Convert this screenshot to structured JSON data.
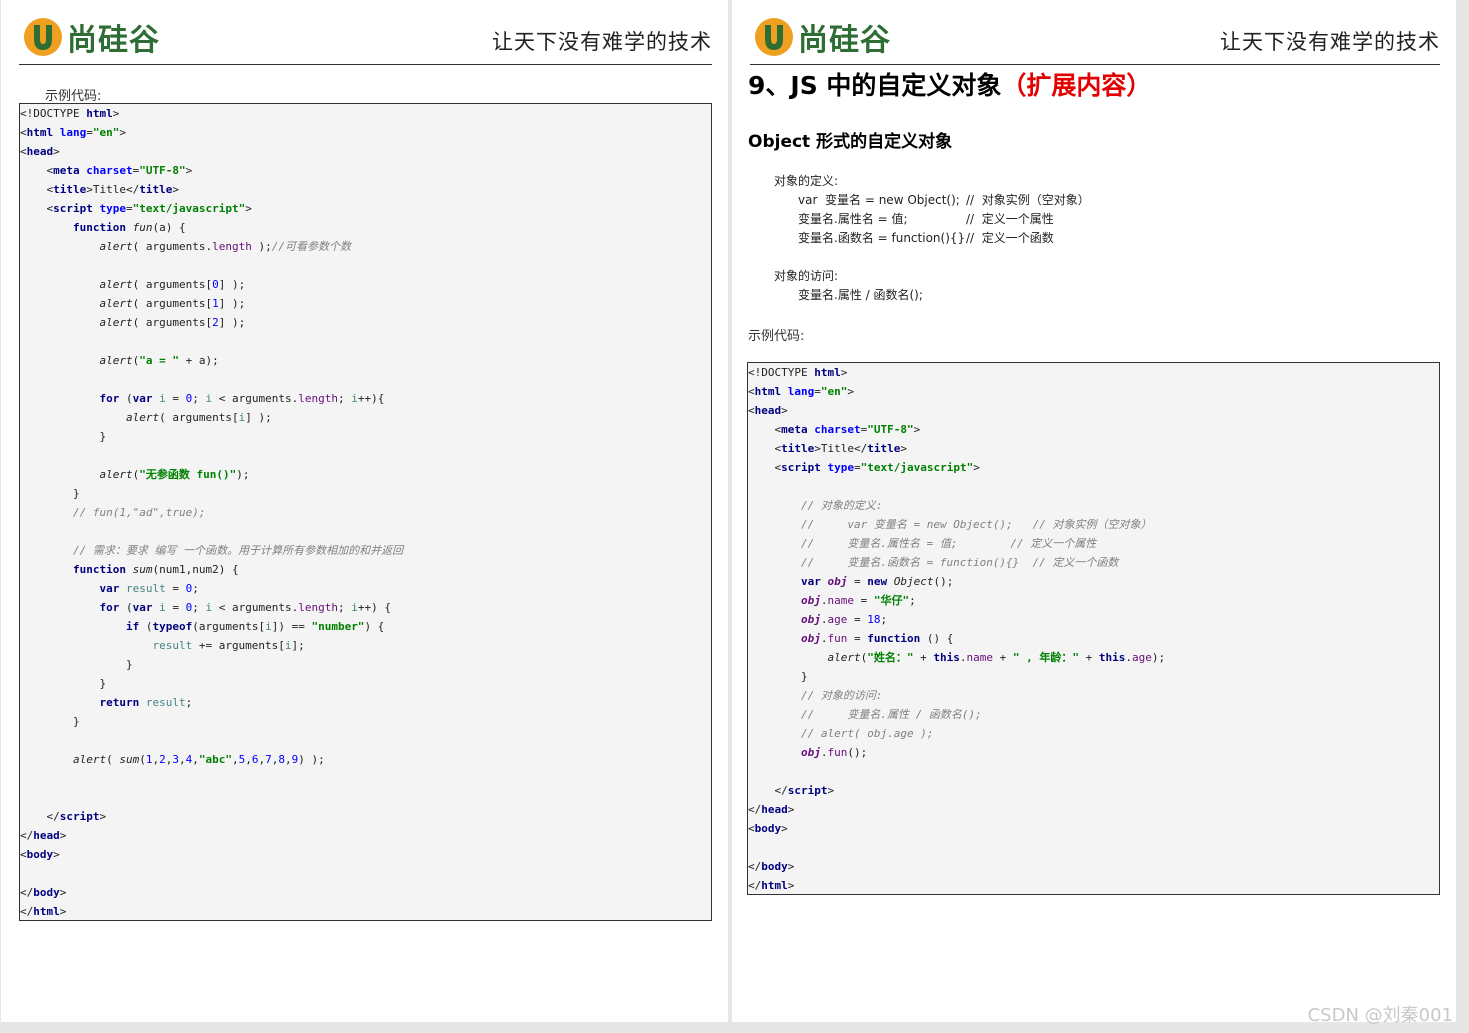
{
  "header": {
    "logo_text": "尚硅谷",
    "slogan": "让天下没有难学的技术"
  },
  "left_page": {
    "example_label": "示例代码:",
    "code_lines": [
      [
        [
          "",
          "<!DOCTYPE "
        ],
        [
          "tag",
          "html"
        ],
        [
          "",
          ">"
        ]
      ],
      [
        [
          "",
          "<"
        ],
        [
          "tag",
          "html "
        ],
        [
          "attr",
          "lang"
        ],
        [
          "",
          "="
        ],
        [
          "str",
          "\"en\""
        ],
        [
          "",
          ">"
        ]
      ],
      [
        [
          "",
          "<"
        ],
        [
          "tag",
          "head"
        ],
        [
          "",
          ">"
        ]
      ],
      [
        [
          "",
          "    <"
        ],
        [
          "tag",
          "meta "
        ],
        [
          "attr",
          "charset"
        ],
        [
          "",
          "="
        ],
        [
          "str",
          "\"UTF-8\""
        ],
        [
          "",
          ">"
        ]
      ],
      [
        [
          "",
          "    <"
        ],
        [
          "tag",
          "title"
        ],
        [
          "",
          ">Title</"
        ],
        [
          "tag",
          "title"
        ],
        [
          "",
          ">"
        ]
      ],
      [
        [
          "",
          "    <"
        ],
        [
          "tag",
          "script "
        ],
        [
          "attr",
          "type"
        ],
        [
          "",
          "="
        ],
        [
          "str",
          "\"text/javascript\""
        ],
        [
          "",
          ">"
        ]
      ],
      [
        [
          "",
          "        "
        ],
        [
          "kw",
          "function "
        ],
        [
          "fn",
          "fun"
        ],
        [
          "",
          "(a) {"
        ]
      ],
      [
        [
          "",
          "            "
        ],
        [
          "fn",
          "alert"
        ],
        [
          "",
          "( arguments."
        ],
        [
          "fld",
          "length"
        ],
        [
          "",
          " );"
        ],
        [
          "cm",
          "//可看参数个数"
        ]
      ],
      [
        [
          "",
          ""
        ]
      ],
      [
        [
          "",
          "            "
        ],
        [
          "fn",
          "alert"
        ],
        [
          "",
          "( arguments["
        ],
        [
          "num",
          "0"
        ],
        [
          "",
          "] );"
        ]
      ],
      [
        [
          "",
          "            "
        ],
        [
          "fn",
          "alert"
        ],
        [
          "",
          "( arguments["
        ],
        [
          "num",
          "1"
        ],
        [
          "",
          "] );"
        ]
      ],
      [
        [
          "",
          "            "
        ],
        [
          "fn",
          "alert"
        ],
        [
          "",
          "( arguments["
        ],
        [
          "num",
          "2"
        ],
        [
          "",
          "] );"
        ]
      ],
      [
        [
          "",
          ""
        ]
      ],
      [
        [
          "",
          "            "
        ],
        [
          "fn",
          "alert"
        ],
        [
          "",
          "("
        ],
        [
          "str",
          "\"a = \""
        ],
        [
          "",
          " + a);"
        ]
      ],
      [
        [
          "",
          ""
        ]
      ],
      [
        [
          "",
          "            "
        ],
        [
          "kw",
          "for "
        ],
        [
          "",
          "("
        ],
        [
          "kw",
          "var "
        ],
        [
          "var",
          "i"
        ],
        [
          "",
          " = "
        ],
        [
          "num",
          "0"
        ],
        [
          "",
          "; "
        ],
        [
          "var",
          "i"
        ],
        [
          "",
          " < arguments."
        ],
        [
          "fld",
          "length"
        ],
        [
          "",
          "; "
        ],
        [
          "var",
          "i"
        ],
        [
          "",
          "++){"
        ]
      ],
      [
        [
          "",
          "                "
        ],
        [
          "fn",
          "alert"
        ],
        [
          "",
          "( arguments["
        ],
        [
          "var",
          "i"
        ],
        [
          "",
          "] );"
        ]
      ],
      [
        [
          "",
          "            }"
        ]
      ],
      [
        [
          "",
          ""
        ]
      ],
      [
        [
          "",
          "            "
        ],
        [
          "fn",
          "alert"
        ],
        [
          "",
          "("
        ],
        [
          "str",
          "\"无参函数 fun()\""
        ],
        [
          "",
          ");"
        ]
      ],
      [
        [
          "",
          "        }"
        ]
      ],
      [
        [
          "",
          "        "
        ],
        [
          "cm",
          "// fun(1,\"ad\",true);"
        ]
      ],
      [
        [
          "",
          ""
        ]
      ],
      [
        [
          "",
          "        "
        ],
        [
          "cm",
          "// 需求：要求 编写 一个函数。用于计算所有参数相加的和并返回"
        ]
      ],
      [
        [
          "",
          "        "
        ],
        [
          "kw",
          "function "
        ],
        [
          "fn",
          "sum"
        ],
        [
          "",
          "(num1,num2) {"
        ]
      ],
      [
        [
          "",
          "            "
        ],
        [
          "kw",
          "var "
        ],
        [
          "var",
          "result"
        ],
        [
          "",
          " = "
        ],
        [
          "num",
          "0"
        ],
        [
          "",
          ";"
        ]
      ],
      [
        [
          "",
          "            "
        ],
        [
          "kw",
          "for "
        ],
        [
          "",
          "("
        ],
        [
          "kw",
          "var "
        ],
        [
          "var",
          "i"
        ],
        [
          "",
          " = "
        ],
        [
          "num",
          "0"
        ],
        [
          "",
          "; "
        ],
        [
          "var",
          "i"
        ],
        [
          "",
          " < arguments."
        ],
        [
          "fld",
          "length"
        ],
        [
          "",
          "; "
        ],
        [
          "var",
          "i"
        ],
        [
          "",
          "++) {"
        ]
      ],
      [
        [
          "",
          "                "
        ],
        [
          "kw",
          "if "
        ],
        [
          "",
          "("
        ],
        [
          "kw",
          "typeof"
        ],
        [
          "",
          "(arguments["
        ],
        [
          "var",
          "i"
        ],
        [
          "",
          "]) == "
        ],
        [
          "str",
          "\"number\""
        ],
        [
          "",
          ") {"
        ]
      ],
      [
        [
          "",
          "                    "
        ],
        [
          "var",
          "result"
        ],
        [
          "",
          " += arguments["
        ],
        [
          "var",
          "i"
        ],
        [
          "",
          "];"
        ]
      ],
      [
        [
          "",
          "                }"
        ]
      ],
      [
        [
          "",
          "            }"
        ]
      ],
      [
        [
          "",
          "            "
        ],
        [
          "kw",
          "return "
        ],
        [
          "var",
          "result"
        ],
        [
          "",
          ";"
        ]
      ],
      [
        [
          "",
          "        }"
        ]
      ],
      [
        [
          "",
          ""
        ]
      ],
      [
        [
          "",
          "        "
        ],
        [
          "fn",
          "alert"
        ],
        [
          "",
          "( "
        ],
        [
          "fn",
          "sum"
        ],
        [
          "",
          "("
        ],
        [
          "num",
          "1"
        ],
        [
          "",
          ","
        ],
        [
          "num",
          "2"
        ],
        [
          "",
          ","
        ],
        [
          "num",
          "3"
        ],
        [
          "",
          ","
        ],
        [
          "num",
          "4"
        ],
        [
          "",
          ","
        ],
        [
          "str",
          "\"abc\""
        ],
        [
          "",
          ","
        ],
        [
          "num",
          "5"
        ],
        [
          "",
          ","
        ],
        [
          "num",
          "6"
        ],
        [
          "",
          ","
        ],
        [
          "num",
          "7"
        ],
        [
          "",
          ","
        ],
        [
          "num",
          "8"
        ],
        [
          "",
          ","
        ],
        [
          "num",
          "9"
        ],
        [
          "",
          ") );"
        ]
      ],
      [
        [
          "",
          ""
        ]
      ],
      [
        [
          "",
          ""
        ]
      ],
      [
        [
          "",
          "    </"
        ],
        [
          "tag",
          "script"
        ],
        [
          "",
          ">"
        ]
      ],
      [
        [
          "",
          "</"
        ],
        [
          "tag",
          "head"
        ],
        [
          "",
          ">"
        ]
      ],
      [
        [
          "",
          "<"
        ],
        [
          "tag",
          "body"
        ],
        [
          "",
          ">"
        ]
      ],
      [
        [
          "",
          ""
        ]
      ],
      [
        [
          "",
          "</"
        ],
        [
          "tag",
          "body"
        ],
        [
          "",
          ">"
        ]
      ],
      [
        [
          "",
          "</"
        ],
        [
          "tag",
          "html"
        ],
        [
          "",
          ">"
        ]
      ]
    ]
  },
  "right_page": {
    "section_title_main": "9、JS 中的自定义对象",
    "section_title_note": "（扩展内容）",
    "subsection_title": "Object 形式的自定义对象",
    "definition": {
      "label": "对象的定义:",
      "rows": [
        [
          "var  变量名 = new Object();",
          "//  对象实例（空对象）"
        ],
        [
          "变量名.属性名 = 值;",
          "//  定义一个属性"
        ],
        [
          "变量名.函数名 = function(){}",
          "//  定义一个函数"
        ]
      ]
    },
    "access": {
      "label": "对象的访问:",
      "text": "变量名.属性 / 函数名();"
    },
    "example_label": "示例代码:",
    "code_lines": [
      [
        [
          "",
          "<!DOCTYPE "
        ],
        [
          "tag",
          "html"
        ],
        [
          "",
          ">"
        ]
      ],
      [
        [
          "",
          "<"
        ],
        [
          "tag",
          "html "
        ],
        [
          "attr",
          "lang"
        ],
        [
          "",
          "="
        ],
        [
          "str",
          "\"en\""
        ],
        [
          "",
          ">"
        ]
      ],
      [
        [
          "",
          "<"
        ],
        [
          "tag",
          "head"
        ],
        [
          "",
          ">"
        ]
      ],
      [
        [
          "",
          "    <"
        ],
        [
          "tag",
          "meta "
        ],
        [
          "attr",
          "charset"
        ],
        [
          "",
          "="
        ],
        [
          "str",
          "\"UTF-8\""
        ],
        [
          "",
          ">"
        ]
      ],
      [
        [
          "",
          "    <"
        ],
        [
          "tag",
          "title"
        ],
        [
          "",
          ">Title</"
        ],
        [
          "tag",
          "title"
        ],
        [
          "",
          ">"
        ]
      ],
      [
        [
          "",
          "    <"
        ],
        [
          "tag",
          "script "
        ],
        [
          "attr",
          "type"
        ],
        [
          "",
          "="
        ],
        [
          "str",
          "\"text/javascript\""
        ],
        [
          "",
          ">"
        ]
      ],
      [
        [
          "",
          ""
        ]
      ],
      [
        [
          "",
          "        "
        ],
        [
          "cm",
          "// 对象的定义:"
        ]
      ],
      [
        [
          "",
          "        "
        ],
        [
          "cm",
          "//     var 变量名 = new Object();   // 对象实例（空对象）"
        ]
      ],
      [
        [
          "",
          "        "
        ],
        [
          "cm",
          "//     变量名.属性名 = 值;        // 定义一个属性"
        ]
      ],
      [
        [
          "",
          "        "
        ],
        [
          "cm",
          "//     变量名.函数名 = function(){}  // 定义一个函数"
        ]
      ],
      [
        [
          "",
          "        "
        ],
        [
          "kw",
          "var "
        ],
        [
          "obj",
          "obj"
        ],
        [
          "",
          " = "
        ],
        [
          "kw",
          "new "
        ],
        [
          "fn",
          "Object"
        ],
        [
          "",
          "();"
        ]
      ],
      [
        [
          "",
          "        "
        ],
        [
          "obj",
          "obj"
        ],
        [
          "",
          "."
        ],
        [
          "fld",
          "name"
        ],
        [
          "",
          " = "
        ],
        [
          "str",
          "\"华仔\""
        ],
        [
          "",
          ";"
        ]
      ],
      [
        [
          "",
          "        "
        ],
        [
          "obj",
          "obj"
        ],
        [
          "",
          "."
        ],
        [
          "fld",
          "age"
        ],
        [
          "",
          " = "
        ],
        [
          "num",
          "18"
        ],
        [
          "",
          ";"
        ]
      ],
      [
        [
          "",
          "        "
        ],
        [
          "obj",
          "obj"
        ],
        [
          "",
          "."
        ],
        [
          "fld",
          "fun"
        ],
        [
          "",
          " = "
        ],
        [
          "kw",
          "function "
        ],
        [
          "",
          "() {"
        ]
      ],
      [
        [
          "",
          "            "
        ],
        [
          "fn",
          "alert"
        ],
        [
          "",
          "("
        ],
        [
          "str",
          "\"姓名：\""
        ],
        [
          "",
          " + "
        ],
        [
          "kw",
          "this"
        ],
        [
          "",
          "."
        ],
        [
          "fld",
          "name"
        ],
        [
          "",
          " + "
        ],
        [
          "str",
          "\" , 年龄：\""
        ],
        [
          "",
          " + "
        ],
        [
          "kw",
          "this"
        ],
        [
          "",
          "."
        ],
        [
          "fld",
          "age"
        ],
        [
          "",
          ");"
        ]
      ],
      [
        [
          "",
          "        }"
        ]
      ],
      [
        [
          "",
          "        "
        ],
        [
          "cm",
          "// 对象的访问:"
        ]
      ],
      [
        [
          "",
          "        "
        ],
        [
          "cm",
          "//     变量名.属性 / 函数名();"
        ]
      ],
      [
        [
          "",
          "        "
        ],
        [
          "cm",
          "// alert( obj.age );"
        ]
      ],
      [
        [
          "",
          "        "
        ],
        [
          "obj",
          "obj"
        ],
        [
          "",
          "."
        ],
        [
          "fld",
          "fun"
        ],
        [
          "",
          "();"
        ]
      ],
      [
        [
          "",
          ""
        ]
      ],
      [
        [
          "",
          "    </"
        ],
        [
          "tag",
          "script"
        ],
        [
          "",
          ">"
        ]
      ],
      [
        [
          "",
          "</"
        ],
        [
          "tag",
          "head"
        ],
        [
          "",
          ">"
        ]
      ],
      [
        [
          "",
          "<"
        ],
        [
          "tag",
          "body"
        ],
        [
          "",
          ">"
        ]
      ],
      [
        [
          "",
          ""
        ]
      ],
      [
        [
          "",
          "</"
        ],
        [
          "tag",
          "body"
        ],
        [
          "",
          ">"
        ]
      ],
      [
        [
          "",
          "</"
        ],
        [
          "tag",
          "html"
        ],
        [
          "",
          ">"
        ]
      ]
    ]
  },
  "watermark": "CSDN @刘秦001"
}
